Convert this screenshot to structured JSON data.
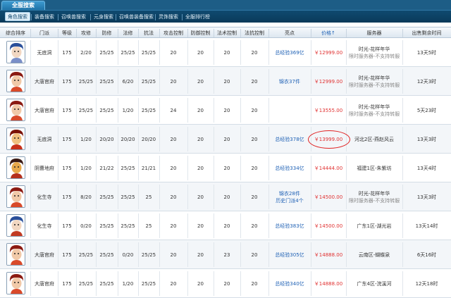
{
  "main_tab": "全服搜索",
  "sub_tabs": [
    "角色搜索",
    "装备搜索",
    "召唤兽搜索",
    "元身搜索",
    "召唤兽装备搜索",
    "灵饰搜索",
    "全服排行榜"
  ],
  "headers": {
    "rank": "综合排序",
    "school": "门派",
    "level": "等级",
    "attack": "攻修",
    "defense": "防修",
    "magic": "法修",
    "resist": "抗法",
    "atk_ctrl": "攻击控制",
    "def_ctrl": "防御控制",
    "mag_ctrl": "法术控制",
    "res_ctrl": "法抗控制",
    "highlight": "亮点",
    "price": "价格↑",
    "server": "服务器",
    "time": "出售剩余时间"
  },
  "rows": [
    {
      "school": "无底洞",
      "level": "175",
      "attack": "2/20",
      "defense": "25/25",
      "magic": "25/25",
      "resist": "25/25",
      "atk_ctrl": "20",
      "def_ctrl": "20",
      "mag_ctrl": "20",
      "res_ctrl": "20",
      "hl1": "总经验369亿",
      "hl2": "",
      "price": "￥12999.00",
      "server1": "时光-花样年华",
      "server2": "限时服务器-不支持转服",
      "time": "13天5时",
      "avatar": "character-portrait-icon"
    },
    {
      "school": "大唐官府",
      "level": "175",
      "attack": "25/25",
      "defense": "25/25",
      "magic": "6/20",
      "resist": "25/25",
      "atk_ctrl": "20",
      "def_ctrl": "20",
      "mag_ctrl": "20",
      "res_ctrl": "20",
      "hl1": "锦衣37件",
      "hl2": "",
      "price": "￥12999.00",
      "server1": "时光-花样年华",
      "server2": "限时服务器-不支持转服",
      "time": "12天3时",
      "avatar": "character-portrait-icon"
    },
    {
      "school": "大唐官府",
      "level": "175",
      "attack": "25/25",
      "defense": "25/25",
      "magic": "1/20",
      "resist": "25/25",
      "atk_ctrl": "24",
      "def_ctrl": "20",
      "mag_ctrl": "20",
      "res_ctrl": "20",
      "hl1": "",
      "hl2": "",
      "price": "￥13555.00",
      "server1": "时光-花样年华",
      "server2": "限时服务器-不支持转服",
      "time": "5天23时",
      "avatar": "character-portrait-icon"
    },
    {
      "school": "无底洞",
      "level": "175",
      "attack": "1/20",
      "defense": "20/20",
      "magic": "20/20",
      "resist": "20/20",
      "atk_ctrl": "20",
      "def_ctrl": "20",
      "mag_ctrl": "20",
      "res_ctrl": "20",
      "hl1": "总经验378亿",
      "hl2": "",
      "price": "￥13999.00",
      "server1": "河北2区-燕赵风云",
      "server2": "",
      "time": "13天3时",
      "avatar": "character-portrait-icon"
    },
    {
      "school": "阴曹地府",
      "level": "175",
      "attack": "1/20",
      "defense": "21/22",
      "magic": "25/25",
      "resist": "21/21",
      "atk_ctrl": "20",
      "def_ctrl": "20",
      "mag_ctrl": "20",
      "res_ctrl": "20",
      "hl1": "总经验334亿",
      "hl2": "",
      "price": "￥14444.00",
      "server1": "福建1区-朱紫坊",
      "server2": "",
      "time": "13天4时",
      "avatar": "character-portrait-icon"
    },
    {
      "school": "化生寺",
      "level": "175",
      "attack": "8/20",
      "defense": "25/25",
      "magic": "25/25",
      "resist": "25",
      "atk_ctrl": "20",
      "def_ctrl": "20",
      "mag_ctrl": "20",
      "res_ctrl": "20",
      "hl1": "锦衣28件",
      "hl2": "历史门派4个",
      "price": "￥14500.00",
      "server1": "时光-花样年华",
      "server2": "限时服务器-不支持转服",
      "time": "13天3时",
      "avatar": "character-portrait-icon"
    },
    {
      "school": "化生寺",
      "level": "175",
      "attack": "0/20",
      "defense": "25/25",
      "magic": "25/25",
      "resist": "25",
      "atk_ctrl": "20",
      "def_ctrl": "20",
      "mag_ctrl": "20",
      "res_ctrl": "20",
      "hl1": "总经验383亿",
      "hl2": "",
      "price": "￥14500.00",
      "server1": "广东1区-湖光岩",
      "server2": "",
      "time": "13天14时",
      "avatar": "character-portrait-icon"
    },
    {
      "school": "大唐官府",
      "level": "175",
      "attack": "25/25",
      "defense": "25/25",
      "magic": "0/20",
      "resist": "25/25",
      "atk_ctrl": "20",
      "def_ctrl": "20",
      "mag_ctrl": "23",
      "res_ctrl": "20",
      "hl1": "总经验305亿",
      "hl2": "",
      "price": "￥14888.00",
      "server1": "云南区-蝴蝶泉",
      "server2": "",
      "time": "6天16时",
      "avatar": "character-portrait-icon"
    },
    {
      "school": "大唐官府",
      "level": "175",
      "attack": "25/25",
      "defense": "25/25",
      "magic": "1/20",
      "resist": "25/25",
      "atk_ctrl": "20",
      "def_ctrl": "20",
      "mag_ctrl": "20",
      "res_ctrl": "20",
      "hl1": "总经验340亿",
      "hl2": "",
      "price": "￥14888.00",
      "server1": "广东4区-浣溪河",
      "server2": "",
      "time": "12天18时",
      "avatar": "character-portrait-icon"
    }
  ],
  "colors": {
    "topbar": "#1d5d86",
    "link_blue": "#1c5fb4",
    "price_red": "#e03030",
    "highlight_circle": "#e02020"
  }
}
